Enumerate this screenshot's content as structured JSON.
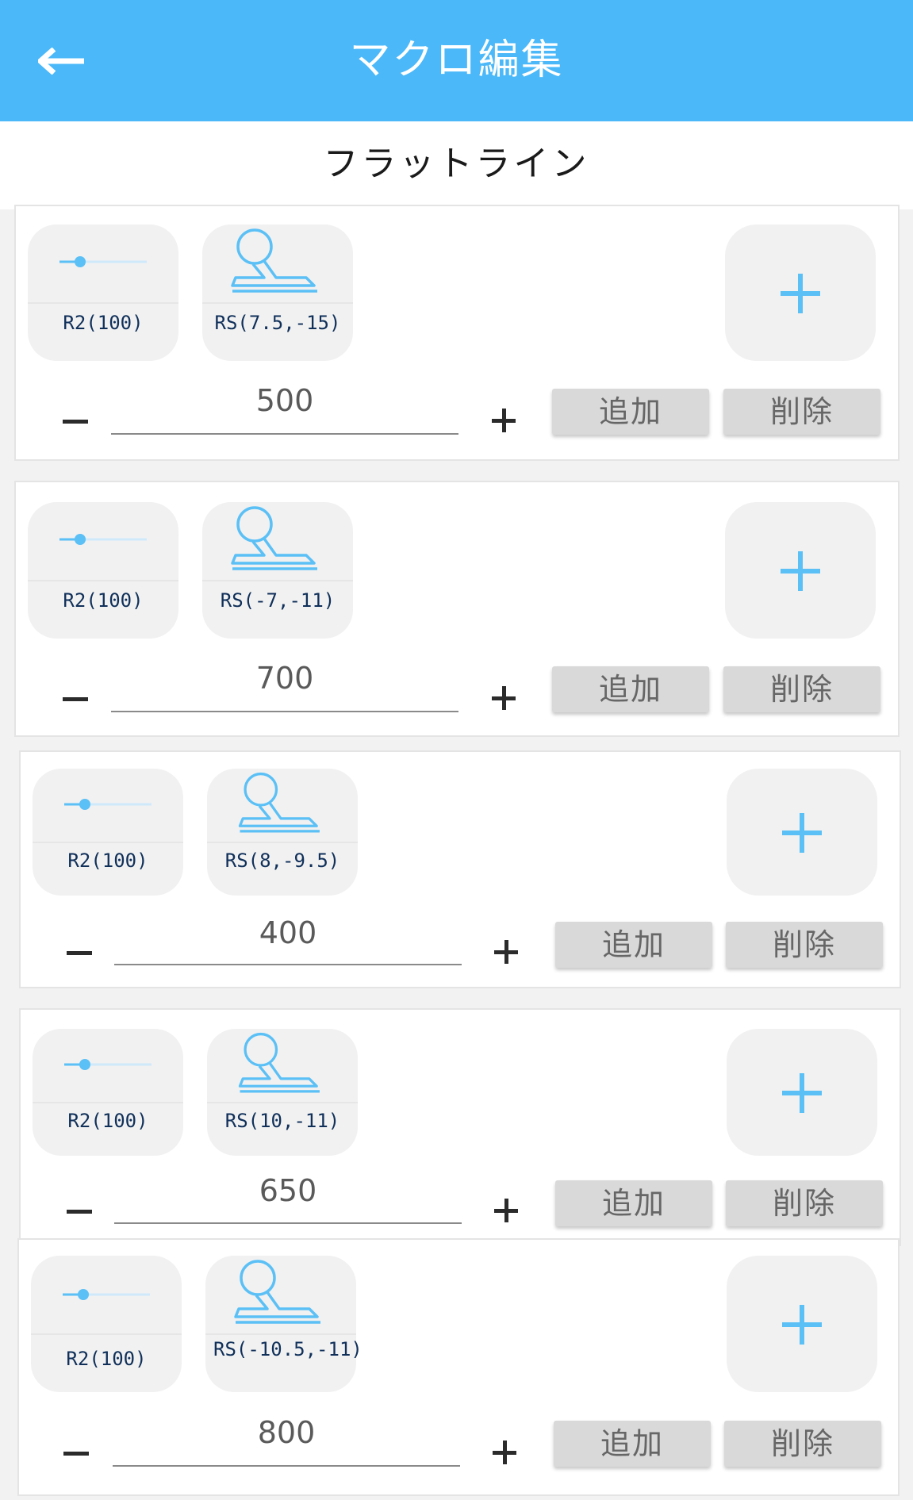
{
  "header": {
    "title": "マクロ編集"
  },
  "macro": {
    "name": "フラットライン"
  },
  "steps": [
    {
      "trigger": "R2(100)",
      "stick": "RS(7.5,-15)",
      "duration": "500"
    },
    {
      "trigger": "R2(100)",
      "stick": "RS(-7,-11)",
      "duration": "700"
    },
    {
      "trigger": "R2(100)",
      "stick": "RS(8,-9.5)",
      "duration": "400"
    },
    {
      "trigger": "R2(100)",
      "stick": "RS(10,-11)",
      "duration": "650"
    },
    {
      "trigger": "R2(100)",
      "stick": "RS(-10.5,-11)",
      "duration": "800"
    }
  ],
  "labels": {
    "add": "追加",
    "delete": "削除"
  },
  "icons": {
    "back": "arrow-left-icon",
    "trigger": "trigger-slider-icon",
    "stick": "analog-stick-icon",
    "add_input": "plus-icon",
    "decrement": "minus-icon",
    "increment": "plus-icon"
  },
  "colors": {
    "appbar": "#4ab8f9",
    "accent": "#5bc0f6",
    "label": "#10305a"
  }
}
